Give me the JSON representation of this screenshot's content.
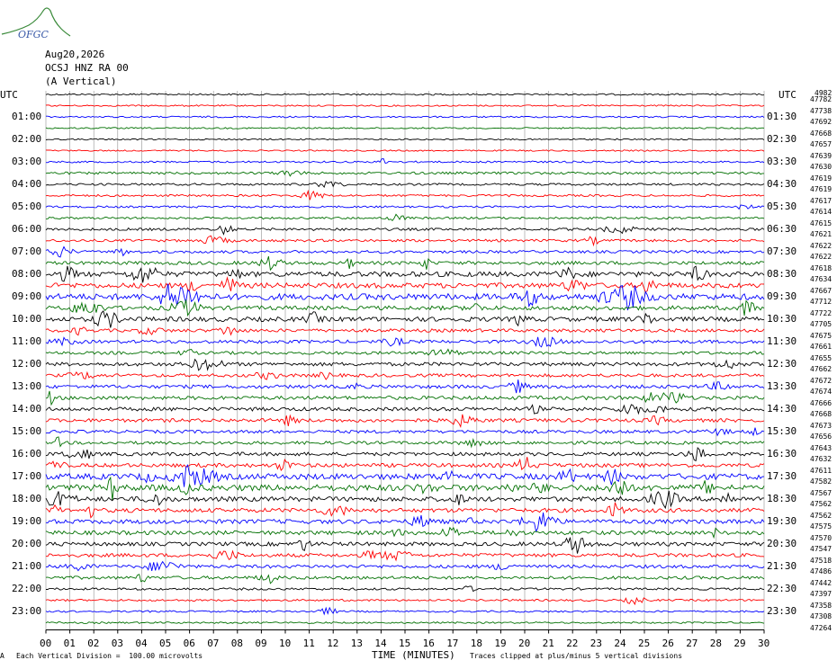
{
  "logo_text": "OFGC",
  "header": {
    "date": "Aug20,2026",
    "station": "OCSJ HNZ RA 00",
    "component": "(A Vertical)"
  },
  "tz_left": "UTC",
  "tz_right": "UTC",
  "corner_code": "4982",
  "bottom_left_glyph": "A",
  "footer": {
    "scale": "Each Vertical Division =  100.00 microvolts",
    "xlabel": "TIME (MINUTES)",
    "clip": "Traces clipped at plus/minus 5 vertical divisions"
  },
  "colors": {
    "trace_cycle": [
      "#000000",
      "#ff0000",
      "#0000ff",
      "#007000"
    ],
    "grid": "#909090",
    "logo": "#3a8a3a",
    "logo_text": "#3a5aa8"
  },
  "chart_data": {
    "type": "helicorder",
    "trace_count": 48,
    "minutes_per_trace": 30,
    "x_ticks": [
      "00",
      "01",
      "02",
      "03",
      "04",
      "05",
      "06",
      "07",
      "08",
      "09",
      "10",
      "11",
      "12",
      "13",
      "14",
      "15",
      "16",
      "17",
      "18",
      "19",
      "20",
      "21",
      "22",
      "23",
      "24",
      "25",
      "26",
      "27",
      "28",
      "29",
      "30"
    ],
    "left_labels": [
      "01:00",
      "02:00",
      "03:00",
      "04:00",
      "05:00",
      "06:00",
      "07:00",
      "08:00",
      "09:00",
      "10:00",
      "11:00",
      "12:00",
      "13:00",
      "14:00",
      "15:00",
      "16:00",
      "17:00",
      "18:00",
      "19:00",
      "20:00",
      "21:00",
      "22:00",
      "23:00"
    ],
    "right_labels": [
      "01:30",
      "02:30",
      "03:30",
      "04:30",
      "05:30",
      "06:30",
      "07:30",
      "08:30",
      "09:30",
      "10:30",
      "11:30",
      "12:30",
      "13:30",
      "14:30",
      "15:30",
      "16:30",
      "17:30",
      "18:30",
      "19:30",
      "20:30",
      "21:30",
      "22:30",
      "23:30"
    ],
    "trace_counts": [
      "47782",
      "47738",
      "47692",
      "47668",
      "47657",
      "47639",
      "47630",
      "47619",
      "47619",
      "47617",
      "47614",
      "47615",
      "47621",
      "47622",
      "47622",
      "47618",
      "47634",
      "47667",
      "47712",
      "47722",
      "47705",
      "47675",
      "47661",
      "47655",
      "47662",
      "47672",
      "47674",
      "47666",
      "47668",
      "47673",
      "47656",
      "47643",
      "47632",
      "47611",
      "47582",
      "47567",
      "47562",
      "47562",
      "47575",
      "47570",
      "47547",
      "47518",
      "47486",
      "47442",
      "47397",
      "47358",
      "47308",
      "47264"
    ],
    "activity": [
      0.08,
      0.06,
      0.07,
      0.05,
      0.05,
      0.04,
      0.1,
      0.18,
      0.14,
      0.14,
      0.12,
      0.14,
      0.2,
      0.2,
      0.22,
      0.32,
      0.55,
      0.55,
      0.7,
      0.42,
      0.48,
      0.3,
      0.3,
      0.26,
      0.35,
      0.3,
      0.32,
      0.35,
      0.36,
      0.34,
      0.28,
      0.28,
      0.34,
      0.38,
      0.65,
      0.7,
      0.5,
      0.42,
      0.44,
      0.4,
      0.38,
      0.34,
      0.3,
      0.28,
      0.16,
      0.12,
      0.1,
      0.08
    ]
  }
}
